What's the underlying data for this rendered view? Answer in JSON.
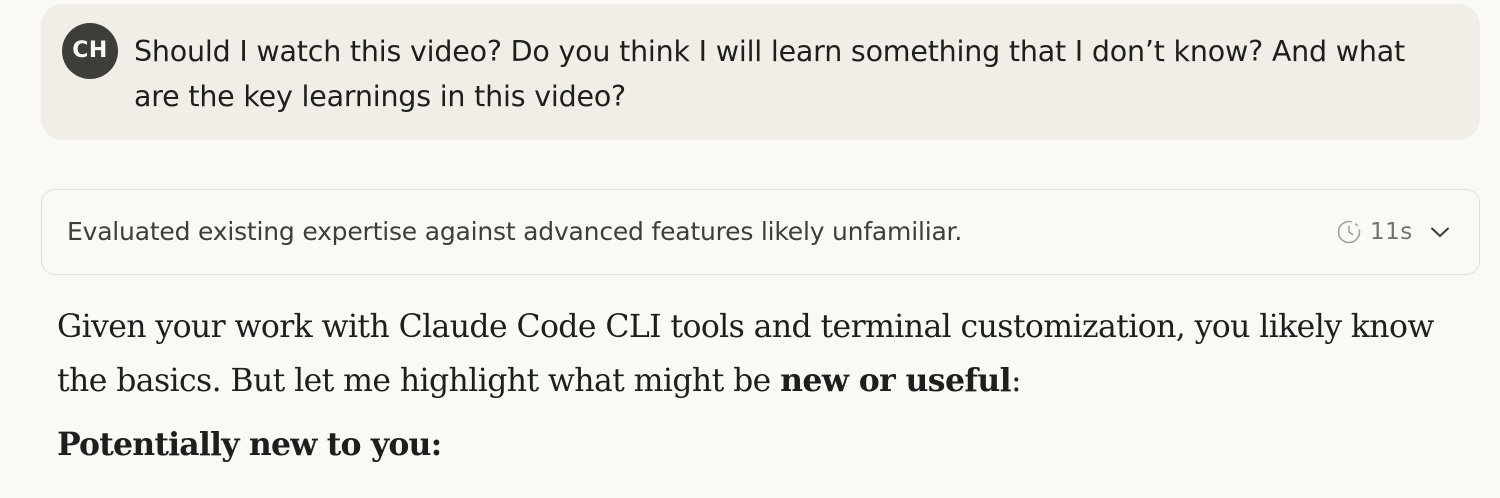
{
  "user_message": {
    "avatar_initials": "CH",
    "text": "Should I watch this video? Do you think I will learn something that I don’t know? And what are the key learnings in this video?"
  },
  "thinking": {
    "summary": "Evaluated existing expertise against advanced features likely unfamiliar.",
    "duration": "11s",
    "timer_icon": "clock-icon",
    "expand_icon": "chevron-down-icon"
  },
  "response": {
    "intro_before_bold": "Given your work with Claude Code CLI tools and terminal customization, you likely know the basics. But let me highlight what might be ",
    "intro_bold": "new or useful",
    "intro_after_bold": ":",
    "section_heading": "Potentially new to you:"
  },
  "colors": {
    "page_background": "#faf9f5",
    "user_bubble_background": "#f0eee6",
    "avatar_background": "#3d3d3a",
    "thinking_border": "#e0ded6",
    "muted_text": "#73726c",
    "primary_text": "#1f1e1d"
  }
}
